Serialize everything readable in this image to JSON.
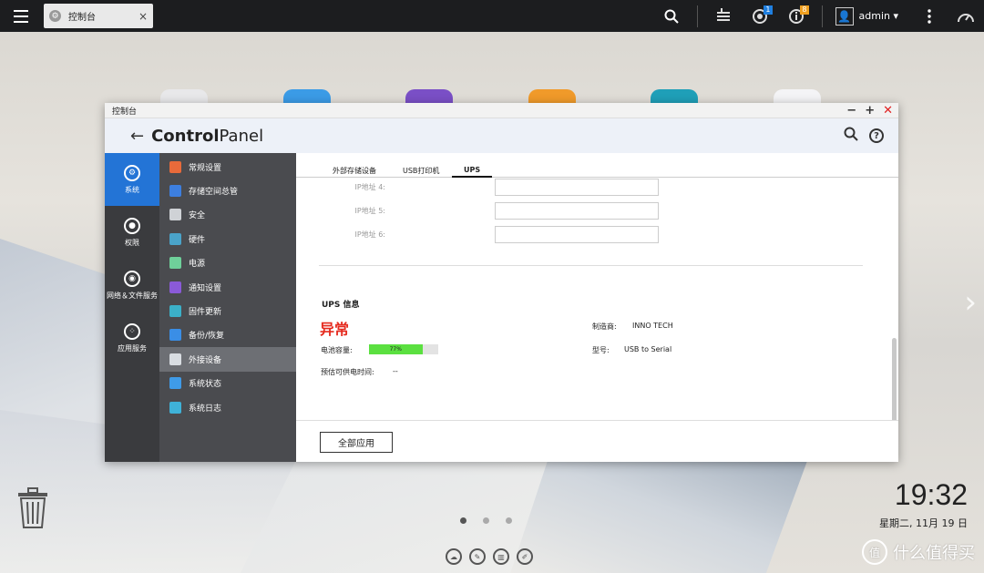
{
  "taskbar": {
    "tab_label": "控制台",
    "tab_close": "×",
    "user_name": "admin ▾",
    "notif_badge_1": "1",
    "notif_badge_2": "8"
  },
  "window": {
    "title": "控制台",
    "header_title_1": "Control",
    "header_title_2": "Panel"
  },
  "categories": [
    {
      "label": "系统"
    },
    {
      "label": "权限"
    },
    {
      "label": "网络＆文件服务"
    },
    {
      "label": "应用服务"
    }
  ],
  "sub_items": [
    {
      "label": "常规设置",
      "color": "#e86a3a"
    },
    {
      "label": "存储空间总管",
      "color": "#3d7fe0"
    },
    {
      "label": "安全",
      "color": "#cfd2d6"
    },
    {
      "label": "硬件",
      "color": "#4aa3c9"
    },
    {
      "label": "电源",
      "color": "#6fd09a"
    },
    {
      "label": "通知设置",
      "color": "#8a5ad8"
    },
    {
      "label": "固件更新",
      "color": "#3bb0c8"
    },
    {
      "label": "备份/恢复",
      "color": "#3a8ee6"
    },
    {
      "label": "外接设备",
      "color": "#d9dde2"
    },
    {
      "label": "系统状态",
      "color": "#3f9be8"
    },
    {
      "label": "系统日志",
      "color": "#3fb2d8"
    }
  ],
  "tabs": {
    "external": "外部存储设备",
    "printer": "USB打印机",
    "ups": "UPS"
  },
  "ip_fields": [
    {
      "label": "IP地址 4:"
    },
    {
      "label": "IP地址 5:"
    },
    {
      "label": "IP地址 6:"
    }
  ],
  "ups": {
    "section_title": "UPS 信息",
    "status": "异常",
    "battery_label": "电池容量:",
    "battery_percent": "77%",
    "battery_fraction": 0.77,
    "time_label": "预估可供电时间:",
    "time_value": "--",
    "manufacturer_label": "制造商:",
    "manufacturer_value": "INNO TECH",
    "model_label": "型号:",
    "model_value": "USB to Serial"
  },
  "footer": {
    "apply_label": "全部应用"
  },
  "desktop": {
    "time": "19:32",
    "date": "星期二, 11月 19 日",
    "watermark": "什么值得买",
    "watermark_logo": "值"
  }
}
